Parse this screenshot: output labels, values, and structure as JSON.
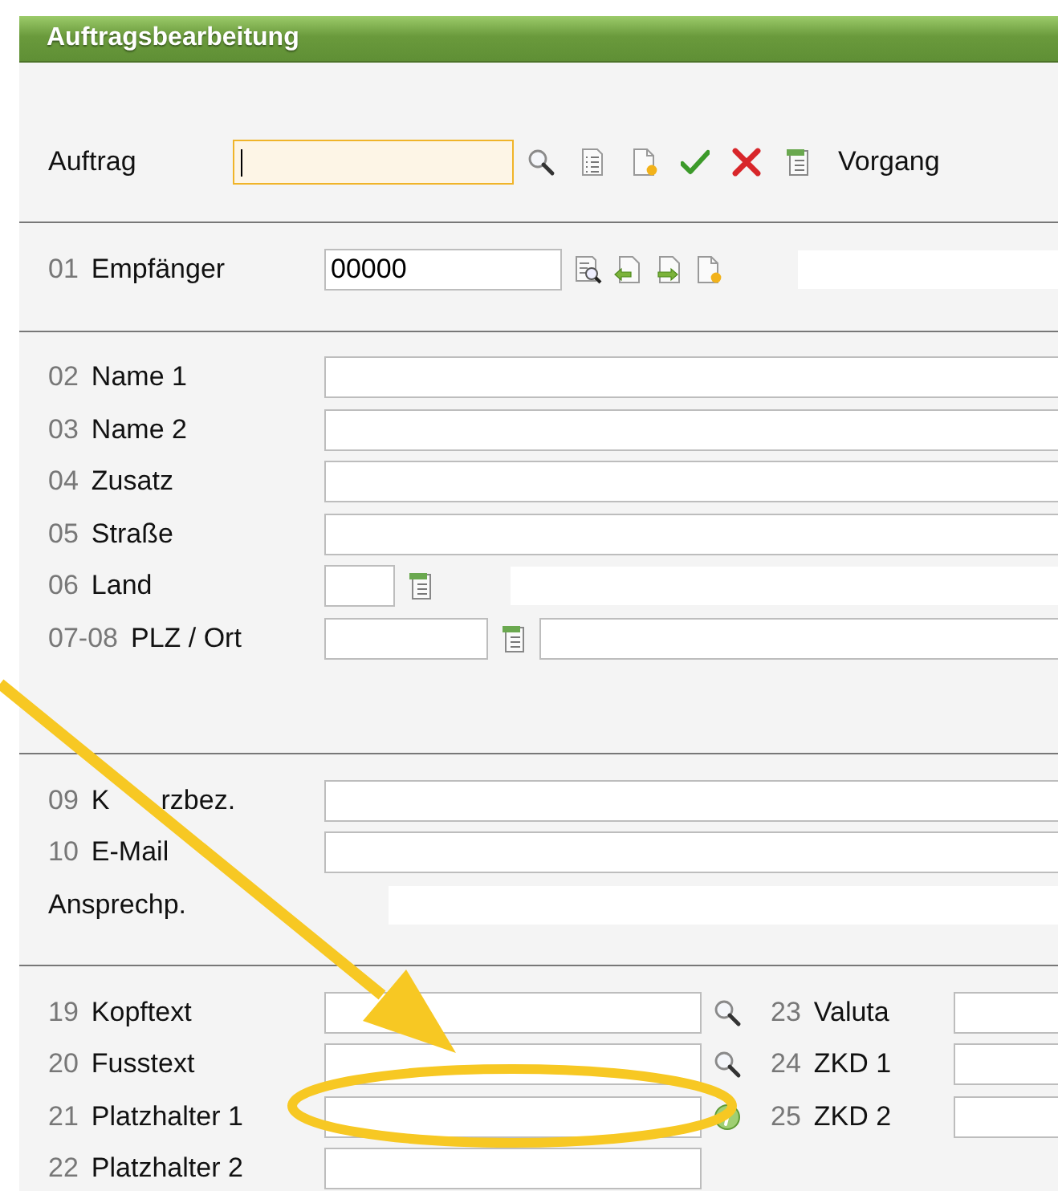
{
  "window": {
    "title": "Auftragsbearbeitung"
  },
  "order_bar": {
    "label": "Auftrag",
    "field": {
      "focused": true
    },
    "tools": [
      {
        "kind": "search"
      },
      {
        "kind": "list"
      },
      {
        "kind": "new"
      },
      {
        "kind": "confirm"
      },
      {
        "kind": "cancel"
      },
      {
        "kind": "table"
      }
    ],
    "process_label": "Vorgang"
  },
  "sections": [
    {
      "rows": [
        {
          "number": "01",
          "label": "Empfänger",
          "cells": [
            {
              "kind": "medium-field",
              "value": "00000"
            },
            {
              "kind": "search-doc"
            },
            {
              "kind": "doc-left"
            },
            {
              "kind": "doc-right"
            },
            {
              "kind": "new"
            },
            {
              "kind": "display"
            }
          ]
        }
      ]
    },
    {
      "rows": [
        {
          "number": "02",
          "label": "Name 1",
          "cells": [
            {
              "kind": "wide-field"
            }
          ]
        },
        {
          "number": "03",
          "label": "Name 2",
          "cells": [
            {
              "kind": "wide-field"
            }
          ]
        },
        {
          "number": "04",
          "label": "Zusatz",
          "cells": [
            {
              "kind": "wide-field"
            }
          ]
        },
        {
          "number": "05",
          "label": "Straße",
          "cells": [
            {
              "kind": "wide-field"
            }
          ]
        },
        {
          "number": "06",
          "label": "Land",
          "cells": [
            {
              "kind": "tiny-field"
            },
            {
              "kind": "table"
            },
            {
              "kind": "display"
            }
          ]
        },
        {
          "number": "07-08",
          "label": "PLZ / Ort",
          "cells": [
            {
              "kind": "small-field"
            },
            {
              "kind": "table"
            },
            {
              "kind": "wide-field"
            }
          ]
        }
      ]
    },
    {
      "rows": [
        {
          "number": "09",
          "label_parts": [
            "K",
            "rzbez."
          ],
          "cells": [
            {
              "kind": "wide-field"
            }
          ]
        },
        {
          "number": "10",
          "label": "E-Mail",
          "cells": [
            {
              "kind": "wide-field"
            }
          ]
        },
        {
          "label": "Ansprechp.",
          "cells": [
            {
              "kind": "display"
            }
          ]
        }
      ]
    },
    {
      "rows": [
        {
          "number": "19",
          "label": "Kopftext",
          "cells": [
            {
              "kind": "large-field"
            },
            {
              "kind": "search"
            }
          ],
          "side": {
            "number": "23",
            "label": "Valuta",
            "cells": [
              {
                "kind": "wide-field"
              }
            ]
          }
        },
        {
          "number": "20",
          "label": "Fusstext",
          "cells": [
            {
              "kind": "large-field"
            },
            {
              "kind": "search"
            }
          ],
          "side": {
            "number": "24",
            "label": "ZKD 1",
            "cells": [
              {
                "kind": "wide-field"
              }
            ]
          }
        },
        {
          "number": "21",
          "label": "Platzhalter 1",
          "cells": [
            {
              "kind": "large-field"
            },
            {
              "kind": "info"
            }
          ],
          "side": {
            "number": "25",
            "label": "ZKD 2",
            "cells": [
              {
                "kind": "wide-field"
              }
            ]
          }
        },
        {
          "number": "22",
          "label": "Platzhalter 2",
          "cells": [
            {
              "kind": "large-field"
            }
          ]
        }
      ]
    }
  ]
}
